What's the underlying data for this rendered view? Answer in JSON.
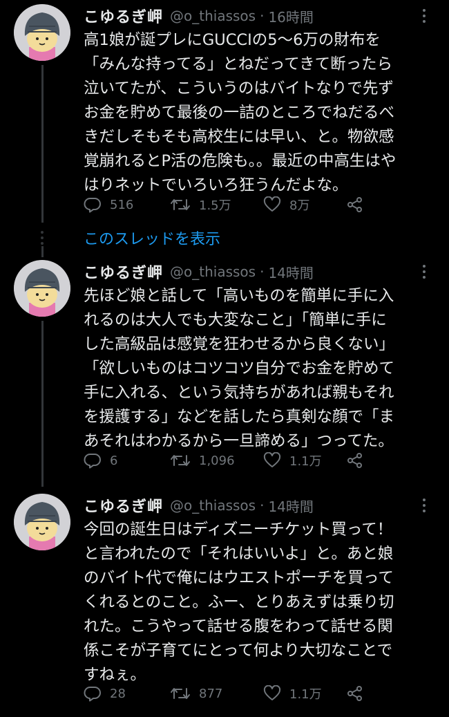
{
  "tweets": [
    {
      "name": "こゆるぎ岬",
      "handle": "@o_thiassos",
      "separator": "·",
      "time": "16時間",
      "lines": [
        "高1娘が誕プレにGUCCIの5〜6万の財布を",
        "「みんな持ってる」とねだってきて断ったら",
        "泣いてたが、こういうのはバイトなりで先ず",
        "お金を貯めて最後の一詰のところでねだるべ",
        "きだしそもそも高校生には早い、と。物欲感",
        "覚崩れるとP活の危険も。。最近の中高生はや",
        "はりネットでいろいろ狂うんだよな。"
      ],
      "replies": "516",
      "retweets": "1.5万",
      "likes": "8万"
    },
    {
      "name": "こゆるぎ岬",
      "handle": "@o_thiassos",
      "separator": "·",
      "time": "14時間",
      "lines": [
        "先ほど娘と話して「高いものを簡単に手に入",
        "れるのは大人でも大変なこと」「簡単に手に",
        "した高級品は感覚を狂わせるから良くない」",
        "「欲しいものはコツコツ自分でお金を貯めて",
        "手に入れる、という気持ちがあれば親もそれ",
        "を援護する」などを話したら真剣な顔で「ま",
        "あそれはわかるから一旦諦める」つってた。"
      ],
      "replies": "6",
      "retweets": "1,096",
      "likes": "1.1万"
    },
    {
      "name": "こゆるぎ岬",
      "handle": "@o_thiassos",
      "separator": "·",
      "time": "14時間",
      "lines": [
        "今回の誕生日はディズニーチケット買って！",
        "と言われたので「それはいいよ」と。あと娘",
        "のバイト代で俺にはウエストポーチを買って",
        "くれるとのこと。ふー、とりあえずは乗り切",
        "れた。こうやって話せる腹をわって話せる関",
        "係こそが子育てにとって何より大切なことで",
        "すねぇ。"
      ],
      "replies": "28",
      "retweets": "877",
      "likes": "1.1万"
    }
  ],
  "show_thread_label": "このスレッドを表示",
  "icons": {
    "reply": "reply-icon",
    "retweet": "retweet-icon",
    "like": "heart-icon",
    "share": "share-icon",
    "more": "more-icon"
  },
  "colors": {
    "background": "#000000",
    "text": "#e7e9ea",
    "muted": "#71767b",
    "link": "#1d9bf0",
    "thread_line": "#333639"
  }
}
